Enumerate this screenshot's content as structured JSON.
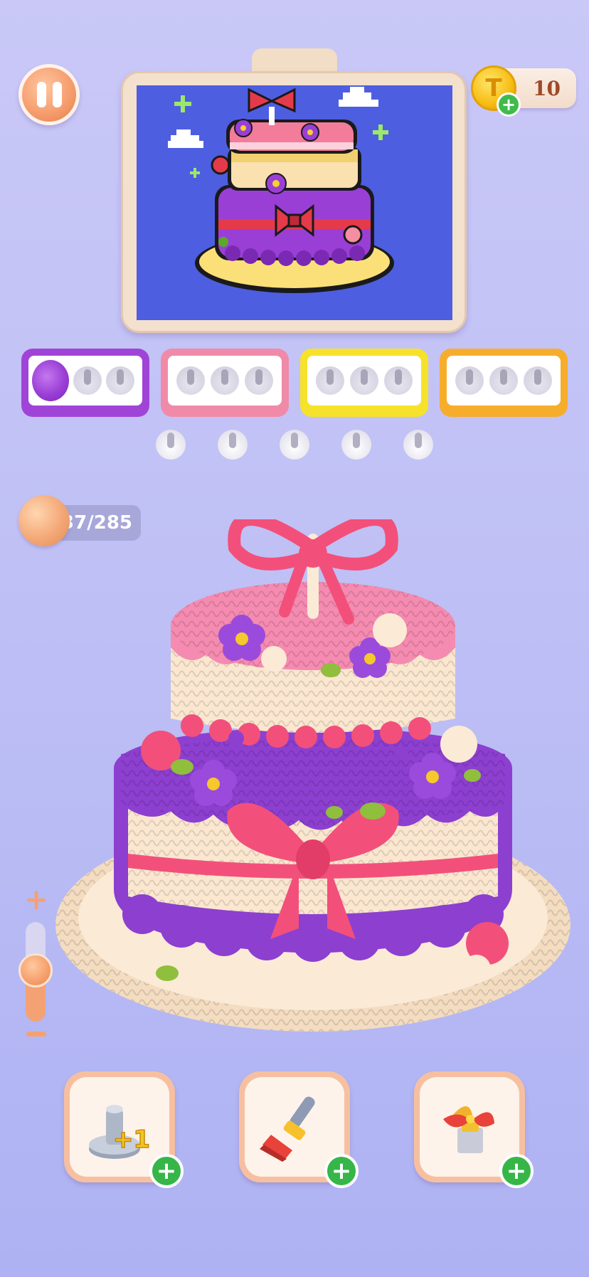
{
  "coins": {
    "value": "10"
  },
  "progress": {
    "text": "37/285"
  },
  "slots": [
    {
      "color": "#a044d8",
      "border": "#8c35c4"
    },
    {
      "color": "#f08aa8",
      "border": "#e06f90"
    },
    {
      "color": "#f6e22a",
      "border": "#e8c90f"
    },
    {
      "color": "#f7ad2c",
      "border": "#ea9412"
    }
  ],
  "powerups": {
    "add_peg_label": "+1"
  },
  "icons": [
    "pause-icon",
    "coin-icon",
    "plus-icon",
    "yarn-ball-icon",
    "peg-icon",
    "brush-icon",
    "magnet-icon",
    "zoom-plus-icon",
    "zoom-minus-icon"
  ]
}
